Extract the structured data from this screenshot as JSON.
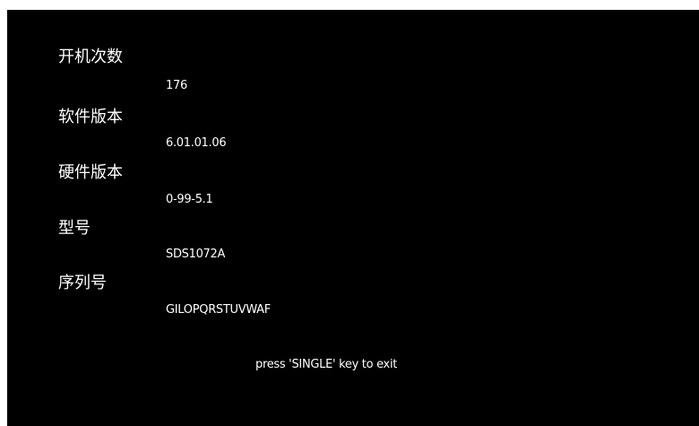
{
  "info": {
    "boot_count": {
      "label": "开机次数",
      "value": "176"
    },
    "software_version": {
      "label": "软件版本",
      "value": "6.01.01.06"
    },
    "hardware_version": {
      "label": "硬件版本",
      "value": "0-99-5.1"
    },
    "model": {
      "label": "型号",
      "value": "SDS1072A"
    },
    "serial_number": {
      "label": "序列号",
      "value": "GILOPQRSTUVWAF"
    }
  },
  "footer": {
    "exit_hint": "press 'SINGLE' key to exit"
  },
  "colors": {
    "background": "#000000",
    "text": "#ffffff"
  }
}
